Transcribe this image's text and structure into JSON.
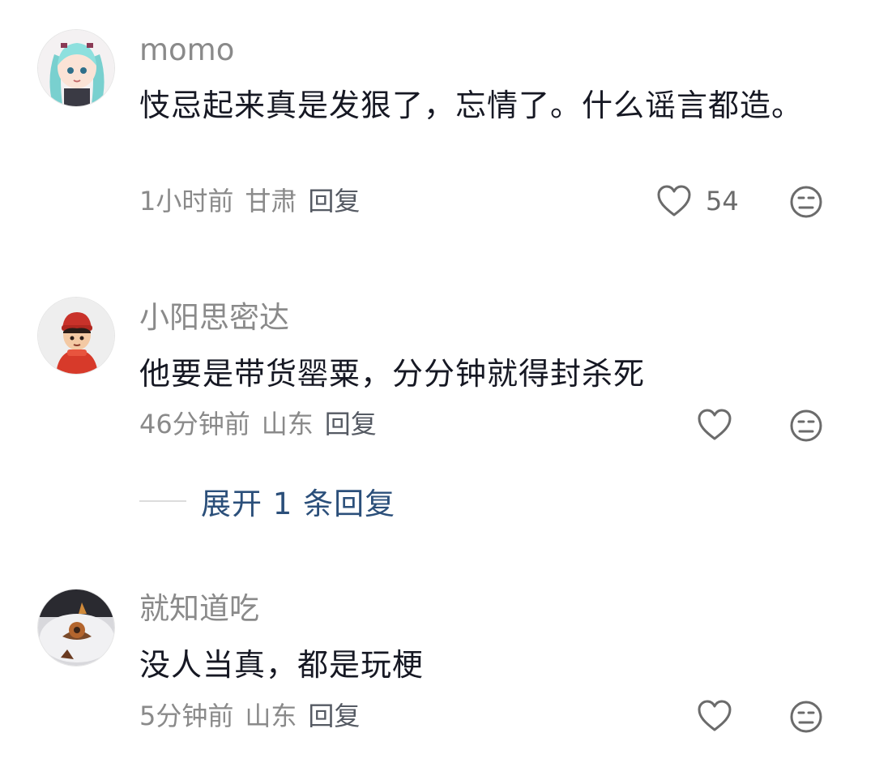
{
  "comments": [
    {
      "username": "momo",
      "text": "忮忌起来真是发狠了，忘情了。什么谣言都造。",
      "time": "1小时前",
      "location": "甘肃",
      "reply_label": "回复",
      "likes": "54",
      "avatar_icon": "anime-girl-avatar"
    },
    {
      "username": "小阳思密达",
      "text": "他要是带货罂粟，分分钟就得封杀死",
      "time": "46分钟前",
      "location": "山东",
      "reply_label": "回复",
      "likes": "",
      "avatar_icon": "cartoon-boy-avatar"
    },
    {
      "username": "就知道吃",
      "text": "没人当真，都是玩梗",
      "time": "5分钟前",
      "location": "山东",
      "reply_label": "回复",
      "likes": "",
      "avatar_icon": "food-photo-avatar"
    }
  ],
  "expand_replies": "展开 1 条回复",
  "colors": {
    "username": "#8a8a8a",
    "text": "#161823",
    "meta": "#8a8a8a",
    "link": "#2b4f7a"
  },
  "icons": [
    "heart-icon",
    "neutral-face-icon"
  ]
}
